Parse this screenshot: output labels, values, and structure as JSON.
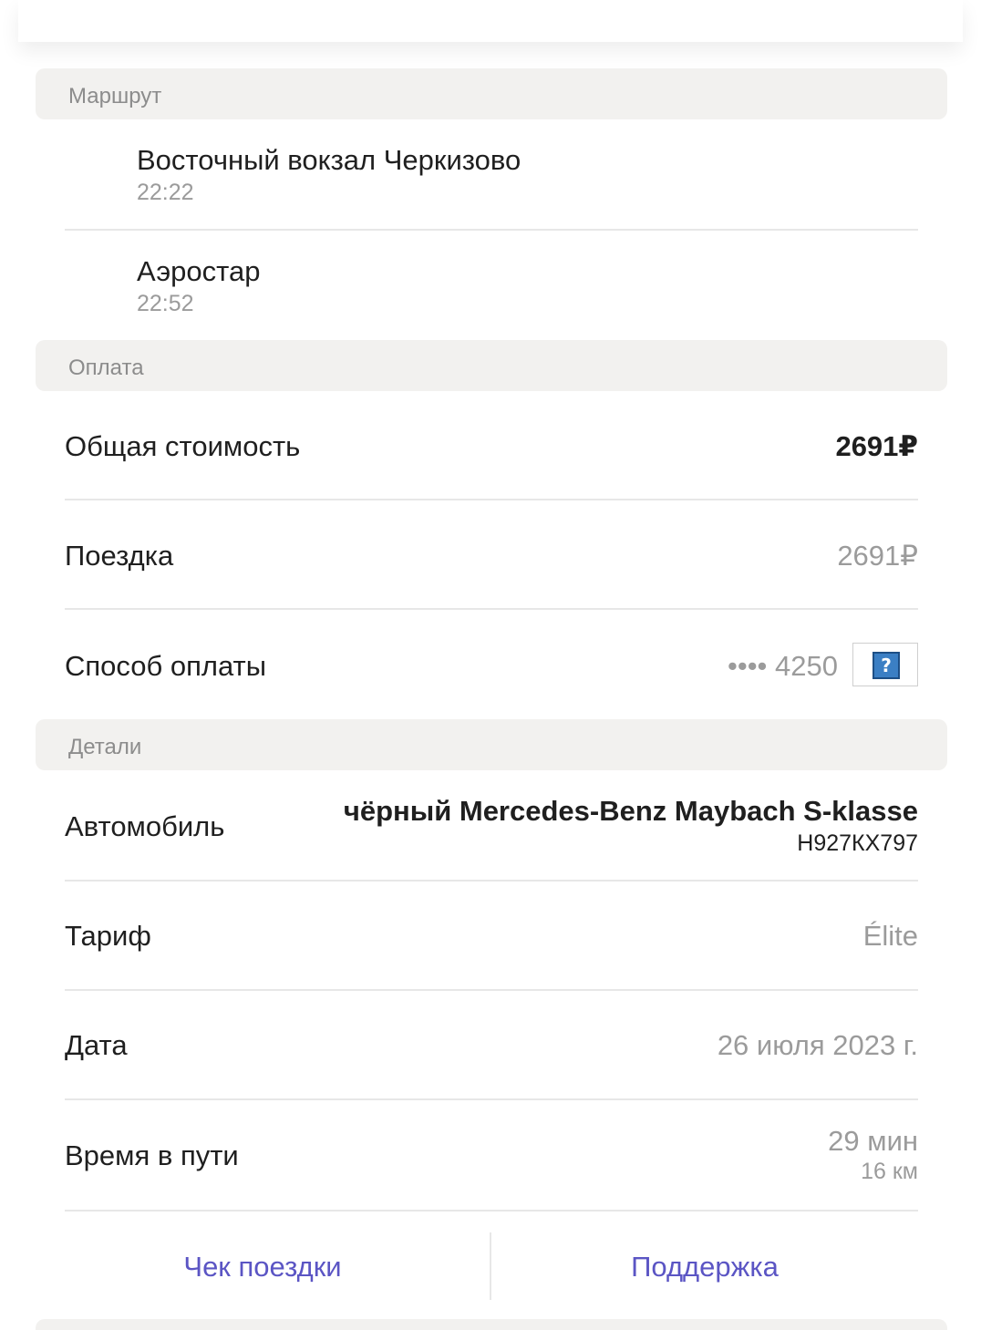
{
  "route": {
    "header": "Маршрут",
    "stops": [
      {
        "name": "Восточный вокзал Черкизово",
        "time": "22:22"
      },
      {
        "name": "Аэростар",
        "time": "22:52"
      }
    ]
  },
  "payment": {
    "header": "Оплата",
    "total_label": "Общая стоимость",
    "total_value": "2691₽",
    "ride_label": "Поездка",
    "ride_value": "2691₽",
    "method_label": "Способ оплаты",
    "card_mask": "•••• 4250",
    "card_icon": "unknown-card-icon",
    "card_icon_glyph": "?"
  },
  "details": {
    "header": "Детали",
    "car_label": "Автомобиль",
    "car_model": "чёрный Mercedes-Benz Maybach S-klasse",
    "car_plate": "Н927КХ797",
    "tariff_label": "Тариф",
    "tariff_value": "Élite",
    "date_label": "Дата",
    "date_value": "26 июля 2023 г.",
    "duration_label": "Время в пути",
    "duration_value": "29 мин",
    "distance_value": "16 км"
  },
  "actions": {
    "receipt_label": "Чек поездки",
    "support_label": "Поддержка"
  },
  "colors": {
    "accent": "#5b55c4",
    "section_bg": "#f2f1ef",
    "secondary_text": "#9b9b9b"
  }
}
